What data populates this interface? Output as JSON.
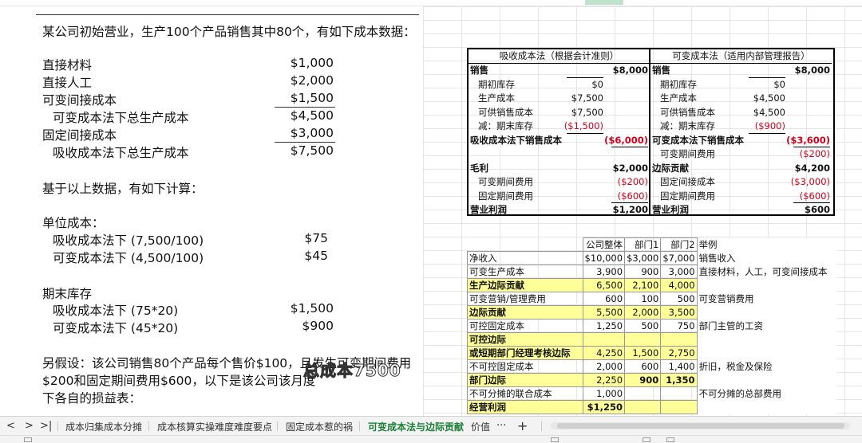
{
  "doc": {
    "intro": "某公司初始营业，生产100个产品销售其中80个，有如下成本数据：",
    "cost_items": [
      {
        "label": "直接材料",
        "value": "$1,000",
        "indent": false
      },
      {
        "label": "直接人工",
        "value": "$2,000",
        "indent": false
      },
      {
        "label": "可变间接成本",
        "value": "$1,500",
        "indent": false
      },
      {
        "label": "可变成本法下总生产成本",
        "value": "$4,500",
        "indent": true
      },
      {
        "label": "固定间接成本",
        "value": "$3,000",
        "indent": false
      },
      {
        "label": "吸收成本法下总生产成本",
        "value": "$7,500",
        "indent": true
      }
    ],
    "calc_heading": "基于以上数据，有如下计算：",
    "unit_cost_heading": "单位成本：",
    "unit_cost": [
      {
        "label": "吸收成本法下 (7,500/100)",
        "value": "$75"
      },
      {
        "label": "可变成本法下 (4,500/100)",
        "value": "$45"
      }
    ],
    "ending_inv_heading": "期末库存",
    "ending_inv": [
      {
        "label": "吸收成本法下 (75*20)",
        "value": "$1,500"
      },
      {
        "label": "可变成本法下 (45*20)",
        "value": "$900"
      }
    ],
    "assume_line1": "另假设：该公司销售80个产品每个售价$100，且发生可变期间费用",
    "assume_line2": "$200和固定期间费用$600，以下是该公司该月度",
    "assume_line3": "下各自的损益表："
  },
  "subtitle": "总成本7500",
  "income_table": {
    "absorption": {
      "header": "吸收成本法（根据会计准则）",
      "rows": [
        {
          "label": "销售",
          "c1": "",
          "c2": "$8,000",
          "bold": true
        },
        {
          "label": "期初库存",
          "c1": "$0",
          "c2": "",
          "indent": true
        },
        {
          "label": "生产成本",
          "c1": "$7,500",
          "c2": "",
          "indent": true
        },
        {
          "label": "可供销售成本",
          "c1": "$7,500",
          "c2": "",
          "indent": true
        },
        {
          "label": "减：期末库存",
          "c1": "($1,500)",
          "c2": "",
          "indent": true,
          "red1": true
        },
        {
          "label": "吸收成本法下销售成本",
          "c1": "",
          "c2": "($6,000)",
          "bold": true,
          "red2": true
        },
        {
          "label": "",
          "c1": "",
          "c2": ""
        },
        {
          "label": "毛利",
          "c1": "",
          "c2": "$2,000",
          "bold": true
        },
        {
          "label": "可变期间费用",
          "c1": "",
          "c2": "($200)",
          "indent": true,
          "red2": true
        },
        {
          "label": "固定期间费用",
          "c1": "",
          "c2": "($600)",
          "indent": true,
          "red2": true
        },
        {
          "label": "营业利润",
          "c1": "",
          "c2": "$1,200",
          "bold": true
        }
      ]
    },
    "variable": {
      "header": "可变成本法（适用内部管理报告）",
      "rows": [
        {
          "label": "销售",
          "c1": "",
          "c2": "$8,000",
          "bold": true
        },
        {
          "label": "期初库存",
          "c1": "$0",
          "c2": "",
          "indent": true
        },
        {
          "label": "生产成本",
          "c1": "$4,500",
          "c2": "",
          "indent": true
        },
        {
          "label": "可供销售成本",
          "c1": "$4,500",
          "c2": "",
          "indent": true
        },
        {
          "label": "减：期末库存",
          "c1": "($900)",
          "c2": "",
          "indent": true,
          "red1": true
        },
        {
          "label": "可变成本法下销售成本",
          "c1": "",
          "c2": "($3,600)",
          "bold": true,
          "red2": true
        },
        {
          "label": "可变期间费用",
          "c1": "",
          "c2": "($200)",
          "indent": true,
          "red2": true
        },
        {
          "label": "边际贡献",
          "c1": "",
          "c2": "$4,200",
          "bold": true
        },
        {
          "label": "固定间接成本",
          "c1": "",
          "c2": "($3,000)",
          "indent": true,
          "red2": true
        },
        {
          "label": "固定期间费用",
          "c1": "",
          "c2": "($600)",
          "indent": true,
          "red2": true
        },
        {
          "label": "营业利润",
          "c1": "",
          "c2": "$600",
          "bold": true
        }
      ]
    }
  },
  "segment_table": {
    "headers": [
      "",
      "公司整体",
      "部门1",
      "部门2",
      "举例"
    ],
    "rows": [
      {
        "label": "净收入",
        "v": [
          "$10,000",
          "$3,000",
          "$7,000"
        ],
        "note": "销售收入"
      },
      {
        "label": "可变生产成本",
        "v": [
          "3,900",
          "900",
          "3,000"
        ],
        "note": "直接材料，人工，可变间接成本"
      },
      {
        "label": "生产边际贡献",
        "v": [
          "6,500",
          "2,100",
          "4,000"
        ],
        "note": "",
        "hl": true,
        "bold": true
      },
      {
        "label": "可变营销/管理费用",
        "v": [
          "600",
          "100",
          "500"
        ],
        "note": "可变营销费用"
      },
      {
        "label": "边际贡献",
        "v": [
          "5,500",
          "2,000",
          "3,500"
        ],
        "note": "",
        "hl": true,
        "bold": true
      },
      {
        "label": "可控固定成本",
        "v": [
          "1,250",
          "500",
          "750"
        ],
        "note": "部门主管的工资"
      },
      {
        "label": "可控边际",
        "v": [
          "",
          "",
          ""
        ],
        "note": "",
        "hl": true,
        "bold": true
      },
      {
        "label": "或短期部门经理考核边际",
        "v": [
          "4,250",
          "1,500",
          "2,750"
        ],
        "note": "",
        "hl": true,
        "bold": true
      },
      {
        "label": "不可控固定成本",
        "v": [
          "2,000",
          "600",
          "1,400"
        ],
        "note": "折旧，税金及保险"
      },
      {
        "label": "部门边际",
        "v": [
          "2,250",
          "900",
          "1,350"
        ],
        "note": "",
        "hl": true,
        "bold": true,
        "boldvals": [
          false,
          true,
          true
        ]
      },
      {
        "label": "不可分摊的联合成本",
        "v": [
          "1,000",
          "",
          ""
        ],
        "note": "不可分摊的总部费用"
      },
      {
        "label": "经营利润",
        "v": [
          "$1,250",
          "",
          ""
        ],
        "note": "",
        "hl": true,
        "bold": true,
        "boldvals": [
          true,
          false,
          false
        ]
      }
    ]
  },
  "tabbar": {
    "nav": [
      "<",
      ">",
      ">|"
    ],
    "tabs": [
      "成本归集成本分摊",
      "成本核算实操难度难度要点",
      "固定成本惹的祸",
      "可变成本法与边际贡献",
      "价值"
    ],
    "active_index": 3,
    "more": "···",
    "add": "+"
  }
}
